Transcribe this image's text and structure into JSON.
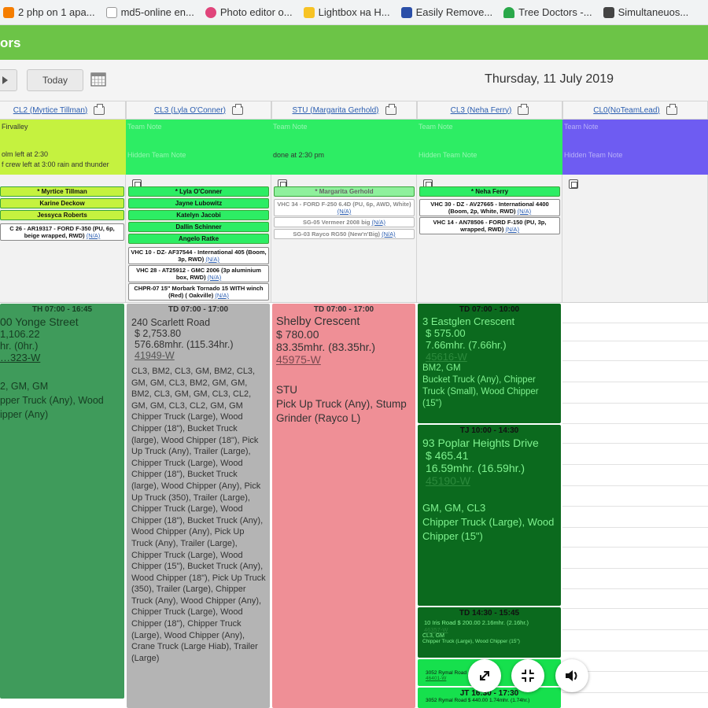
{
  "bookmarks": [
    {
      "label": "2 php on 1 apa...",
      "icon": "blogger-icon",
      "color": "#f57d00"
    },
    {
      "label": "md5-online en...",
      "icon": "page-icon",
      "color": "#ffffff"
    },
    {
      "label": "Photo editor o...",
      "icon": "photo-editor-icon",
      "color": "#e0457b"
    },
    {
      "label": "Lightbox на Н...",
      "icon": "lightbox-icon",
      "color": "#f7c325"
    },
    {
      "label": "Easily Remove...",
      "icon": "checker-icon",
      "color": "#2b4fa8"
    },
    {
      "label": "Tree Doctors -...",
      "icon": "tree-icon",
      "color": "#2aa84a"
    },
    {
      "label": "Simultaneuos...",
      "icon": "cat-icon",
      "color": "#444444"
    }
  ],
  "header": {
    "title": "ors"
  },
  "toolbar": {
    "today_label": "Today",
    "date_title": "Thursday, 11 July 2019"
  },
  "columns": [
    {
      "label": "CL2 (Myrtice Tillman)"
    },
    {
      "label": "CL3 (Lyla O'Conner)"
    },
    {
      "label": "STU (Margarita Gerhold)"
    },
    {
      "label": "CL3 (Neha Ferry)"
    },
    {
      "label": "CL0(NoTeamLead)"
    }
  ],
  "notes": {
    "col0_team": "Firvalley",
    "col0_hidden_1": "olm left at 2:30",
    "col0_hidden_2": "f crew left at 3:00 rain and thunder",
    "col1_team": "Team Note",
    "col1_hidden": "Hidden Team Note",
    "col2_team": "Team Note",
    "col2_hidden": "done at 2:30 pm",
    "col3_team": "Team Note",
    "col3_hidden": "Hidden Team Note",
    "col4_team": "Team Note",
    "col4_hidden": "Hidden Team Note"
  },
  "crews": {
    "col0": [
      "* Myrtice Tillman",
      "Karine Deckow",
      "Jessyca Roberts"
    ],
    "col1": [
      "* Lyla O'Conner",
      "Jayne Lubowitz",
      "Katelyn Jacobi",
      "Dallin Schinner",
      "Angelo Ratke"
    ],
    "col2": [
      "* Margarita Gerhold"
    ],
    "col3": [
      "* Neha Ferry"
    ]
  },
  "vehicles": {
    "col0": [
      "C 26 - AR19317 - FORD F-350 (PU, 6p, beige wrapped, RWD)"
    ],
    "col1": [
      "VHC 10 - DZ- AF37544 - International 405 (Boom, 3p, RWD)",
      "VHC 28 - AT25912 - GMC 2006 (3p aluminium box, RWD)",
      "CHPR-07 15\" Morbark Tornado 15 WITH winch (Red) ( Oakville)"
    ],
    "col2": [
      "VHC 34 - FORD F-250 6.4D (PU, 6p, AWD, White)",
      "SG-05 Vermeer 2008 big",
      "SG-03 Rayco RG50 (New'n'Big)"
    ],
    "col3": [
      "VHC 30 - DZ - AV27665 - International 4400 (Boom, 2p, White, RWD)",
      "VHC 14 - AN78506 - FORD F-150 (PU, 3p, wrapped, RWD)"
    ],
    "na_label": "(N/A)"
  },
  "jobs": {
    "j0": {
      "time": "TH 07:00 - 16:45",
      "address": "00 Yonge Street",
      "price": "1,106.22",
      "hours": "hr. (0hr.)",
      "wo": "…323-W",
      "tags": "2, GM, GM",
      "equip": "pper Truck (Any), Wood ipper (Any)"
    },
    "j1": {
      "time": "TD 07:00 - 17:00",
      "address": "240 Scarlett Road",
      "price": "$ 2,753.80",
      "hours": "576.68mhr. (115.34hr.)",
      "wo": "41949-W",
      "tags": "CL3, BM2, CL3, GM, BM2, CL3, GM, GM, CL3, BM2, GM, GM, BM2, CL3, GM, GM, CL3, CL2, GM, GM, CL3, CL2, GM, GM Chipper Truck (Large), Wood Chipper (18\"), Bucket Truck (large), Wood Chipper (18\"), Pick Up Truck (Any), Trailer (Large), Chipper Truck (Large), Wood Chipper (18\"), Bucket Truck (large), Wood Chipper (Any), Pick Up Truck (350), Trailer (Large), Chipper Truck (Large), Wood Chipper (18\"), Bucket Truck (Any), Wood Chipper (Any), Pick Up Truck (Any), Trailer (Large), Chipper Truck (Large), Wood Chipper (15\"), Bucket Truck (Any), Wood Chipper (18\"), Pick Up Truck (350), Trailer (Large), Chipper Truck (Any), Wood Chipper (Any), Chipper Truck (Large), Wood Chipper (18\"), Chipper Truck (Large), Wood Chipper (Any), Crane Truck (Large Hiab), Trailer (Large)"
    },
    "j2": {
      "time": "TD 07:00 - 17:00",
      "address": "Shelby Crescent",
      "price": "$ 780.00",
      "hours": "83.35mhr. (83.35hr.)",
      "wo": "45975-W",
      "tags": "STU",
      "equip": "Pick Up Truck (Any), Stump Grinder (Rayco L)"
    },
    "j3": {
      "time": "TD 07:00 - 10:00",
      "address": "3 Eastglen Crescent",
      "price": "$ 575.00",
      "hours": "7.66mhr. (7.66hr.)",
      "wo": "45616-W",
      "tags": "BM2, GM",
      "equip": "Bucket Truck (Any), Chipper Truck (Small), Wood Chipper (15\")"
    },
    "j4": {
      "time": "TJ 10:00 - 14:30",
      "address": "93 Poplar Heights Drive",
      "price": "$ 465.41",
      "hours": "16.59mhr. (16.59hr.)",
      "wo": "45190-W",
      "tags": "GM, GM, CL3",
      "equip": "Chipper Truck (Large), Wood Chipper (15\")"
    },
    "j5": {
      "time": "TD 14:30 - 15:45",
      "line1": "10 Iris Road   $ 200.00   2.16mhr. (2.16hr.)",
      "wo": "46357-W",
      "tags": "CL3, GM",
      "equip": "Chipper Truck (Large), Wood Chipper (15\")"
    },
    "j6": {
      "line1": "3052 Rymal Road",
      "wo": "46401-W"
    },
    "j7": {
      "time": "JT 16:30 - 17:30",
      "line1": "3052 Rymal Road  $ 440.00  1.74mhr. (1.74hr.)"
    }
  },
  "colors": {
    "header_green": "#6cc447",
    "job_green": "#3f9b5b",
    "job_gray": "#b4b4b4",
    "job_pink": "#ef8f96",
    "job_dark_green": "#0b6a1e",
    "job_bright_green": "#16e04d",
    "crew_green": "#2ded64",
    "note_purple": "#6e5cf2"
  }
}
